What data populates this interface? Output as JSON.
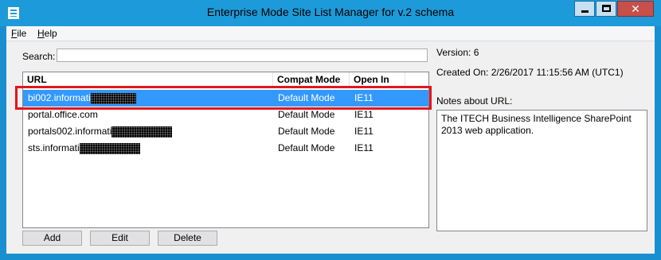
{
  "window": {
    "title": "Enterprise Mode Site List Manager for v.2 schema",
    "close_glyph": "✕",
    "accent_color": "#1d9ad9",
    "icons": [
      "app-icon",
      "minimize-icon",
      "maximize-icon",
      "close-icon"
    ]
  },
  "menu": {
    "file_key": "F",
    "file_rest": "ile",
    "help_key": "H",
    "help_rest": "elp"
  },
  "search": {
    "label": "Search:",
    "value": ""
  },
  "table": {
    "headers": [
      "URL",
      "Compat Mode",
      "Open In"
    ],
    "rows": [
      {
        "url": "bi002.informati",
        "compat": "Default Mode",
        "open_in": "IE11",
        "selected": true,
        "redacted": true
      },
      {
        "url": "portal.office.com",
        "compat": "Default Mode",
        "open_in": "IE11",
        "selected": false,
        "redacted": false
      },
      {
        "url": "portals002.informati",
        "compat": "Default Mode",
        "open_in": "IE11",
        "selected": false,
        "redacted": true
      },
      {
        "url": "sts.informati",
        "compat": "Default Mode",
        "open_in": "IE11",
        "selected": false,
        "redacted": true
      }
    ],
    "highlight_color": "#e4151c",
    "selection_color": "#3399ff"
  },
  "info": {
    "version_label": "Version:",
    "version_value": "6",
    "created_label": "Created On:",
    "created_value": "2/26/2017 11:15:56 AM (UTC1)",
    "notes_label": "Notes about URL:",
    "notes_value": "The ITECH Business Intelligence SharePoint 2013 web application."
  },
  "buttons": {
    "add": "Add",
    "edit": "Edit",
    "delete": "Delete"
  }
}
